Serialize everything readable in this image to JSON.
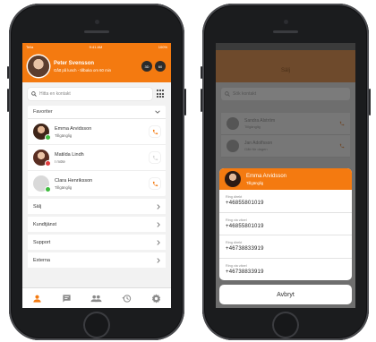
{
  "colors": {
    "accent": "#f47a10",
    "available": "#3dbb3d",
    "dark_button": "#2b2b2b"
  },
  "left": {
    "status_bar": {
      "carrier": "Telia",
      "time": "9:41 AM",
      "battery": "100%"
    },
    "header": {
      "name": "Peter Svensson",
      "status": "Gått på lunch - tillbaka om 60 min",
      "button1": "3D",
      "button2": "60",
      "avatar_icon": "avatar-photo"
    },
    "search": {
      "placeholder": "Hitta en kontakt",
      "icon": "search-icon",
      "dialpad_icon": "dialpad-icon"
    },
    "favorites": {
      "label": "Favoriter",
      "contacts": [
        {
          "name": "Emma Arvidsson",
          "status": "Tillgänglig",
          "presence": "available"
        },
        {
          "name": "Matilda Lindh",
          "status": "I möte",
          "presence": "busy"
        },
        {
          "name": "Clara Henriksson",
          "status": "Tillgänglig",
          "presence": "available"
        }
      ]
    },
    "groups": [
      "Sälj",
      "Kundtjänst",
      "Support",
      "Externa"
    ],
    "tabs": [
      "person-icon",
      "chat-icon",
      "groups-icon",
      "history-icon",
      "settings-icon"
    ]
  },
  "right": {
    "header_title": "Sälj",
    "search_placeholder": "Sök kontakt",
    "background_contacts": [
      {
        "name": "Sandra Alström",
        "status": "Tillgänglig"
      },
      {
        "name": "Jan Adolfsson",
        "status": "Gått för dagen"
      }
    ],
    "sheet": {
      "name": "Emma Arvidsson",
      "status": "Tillgänglig",
      "numbers": [
        {
          "label": "Ring direkt",
          "value": "+46855801019"
        },
        {
          "label": "Ring via växel",
          "value": "+46855801019"
        },
        {
          "label": "Ring direkt",
          "value": "+46738833919"
        },
        {
          "label": "Ring via växel",
          "value": "+46738833919"
        }
      ],
      "cancel_label": "Avbryt"
    }
  }
}
